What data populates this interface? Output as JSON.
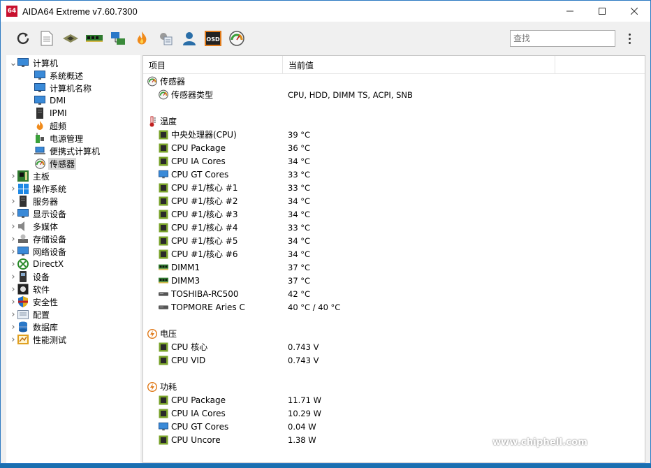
{
  "window": {
    "title": "AIDA64 Extreme v7.60.7300",
    "app_icon_text": "64"
  },
  "toolbar": {
    "icons": [
      "refresh-icon",
      "report-icon",
      "motherboard-icon",
      "memory-icon",
      "network-icon",
      "flame-icon",
      "tools-icon",
      "user-icon",
      "osd-icon",
      "sensor-gauge-icon"
    ],
    "osd_label": "OSD",
    "search_placeholder": "查找"
  },
  "tree": {
    "items": [
      {
        "label": "计算机",
        "level": 0,
        "expanded": true,
        "icon": "computer-icon"
      },
      {
        "label": "系统概述",
        "level": 1,
        "icon": "monitor-icon"
      },
      {
        "label": "计算机名称",
        "level": 1,
        "icon": "monitor-icon"
      },
      {
        "label": "DMI",
        "level": 1,
        "icon": "monitor-icon"
      },
      {
        "label": "IPMI",
        "level": 1,
        "icon": "server-icon"
      },
      {
        "label": "超频",
        "level": 1,
        "icon": "flame-icon"
      },
      {
        "label": "电源管理",
        "level": 1,
        "icon": "battery-icon"
      },
      {
        "label": "便携式计算机",
        "level": 1,
        "icon": "laptop-icon"
      },
      {
        "label": "传感器",
        "level": 1,
        "icon": "sensor-gauge-icon",
        "selected": true
      },
      {
        "label": "主板",
        "level": 0,
        "icon": "motherboard-icon"
      },
      {
        "label": "操作系统",
        "level": 0,
        "icon": "windows-icon"
      },
      {
        "label": "服务器",
        "level": 0,
        "icon": "server-icon"
      },
      {
        "label": "显示设备",
        "level": 0,
        "icon": "monitor-icon"
      },
      {
        "label": "多媒体",
        "level": 0,
        "icon": "speaker-icon"
      },
      {
        "label": "存储设备",
        "level": 0,
        "icon": "storage-icon"
      },
      {
        "label": "网络设备",
        "level": 0,
        "icon": "network-icon"
      },
      {
        "label": "DirectX",
        "level": 0,
        "icon": "xbox-icon"
      },
      {
        "label": "设备",
        "level": 0,
        "icon": "device-icon"
      },
      {
        "label": "软件",
        "level": 0,
        "icon": "software-icon"
      },
      {
        "label": "安全性",
        "level": 0,
        "icon": "shield-icon"
      },
      {
        "label": "配置",
        "level": 0,
        "icon": "config-icon"
      },
      {
        "label": "数据库",
        "level": 0,
        "icon": "database-icon"
      },
      {
        "label": "性能测试",
        "level": 0,
        "icon": "benchmark-icon"
      }
    ]
  },
  "table": {
    "columns": [
      "项目",
      "当前值"
    ],
    "sections": [
      {
        "title": "传感器",
        "icon": "sensor-gauge-icon",
        "rows": [
          {
            "name": "传感器类型",
            "value": "CPU, HDD, DIMM TS, ACPI, SNB",
            "icon": "sensor-gauge-icon"
          }
        ]
      },
      {
        "title": "温度",
        "icon": "thermometer-icon",
        "rows": [
          {
            "name": "中央处理器(CPU)",
            "value": "39 °C",
            "icon": "cpu-chip-icon"
          },
          {
            "name": "CPU Package",
            "value": "36 °C",
            "icon": "cpu-chip-icon"
          },
          {
            "name": "CPU IA Cores",
            "value": "34 °C",
            "icon": "cpu-chip-icon"
          },
          {
            "name": "CPU GT Cores",
            "value": "33 °C",
            "icon": "monitor-icon"
          },
          {
            "name": "CPU #1/核心 #1",
            "value": "33 °C",
            "icon": "cpu-chip-icon"
          },
          {
            "name": "CPU #1/核心 #2",
            "value": "34 °C",
            "icon": "cpu-chip-icon"
          },
          {
            "name": "CPU #1/核心 #3",
            "value": "34 °C",
            "icon": "cpu-chip-icon"
          },
          {
            "name": "CPU #1/核心 #4",
            "value": "33 °C",
            "icon": "cpu-chip-icon"
          },
          {
            "name": "CPU #1/核心 #5",
            "value": "34 °C",
            "icon": "cpu-chip-icon"
          },
          {
            "name": "CPU #1/核心 #6",
            "value": "34 °C",
            "icon": "cpu-chip-icon"
          },
          {
            "name": "DIMM1",
            "value": "37 °C",
            "icon": "memory-icon"
          },
          {
            "name": "DIMM3",
            "value": "37 °C",
            "icon": "memory-icon"
          },
          {
            "name": "TOSHIBA-RC500",
            "value": "42 °C",
            "icon": "drive-icon"
          },
          {
            "name": "TOPMORE Aries C",
            "value": "40 °C / 40 °C",
            "icon": "drive-icon"
          }
        ]
      },
      {
        "title": "电压",
        "icon": "voltage-icon",
        "rows": [
          {
            "name": "CPU 核心",
            "value": "0.743 V",
            "icon": "cpu-chip-icon"
          },
          {
            "name": "CPU VID",
            "value": "0.743 V",
            "icon": "cpu-chip-icon"
          }
        ]
      },
      {
        "title": "功耗",
        "icon": "power-icon",
        "rows": [
          {
            "name": "CPU Package",
            "value": "11.71 W",
            "icon": "cpu-chip-icon"
          },
          {
            "name": "CPU IA Cores",
            "value": "10.29 W",
            "icon": "cpu-chip-icon"
          },
          {
            "name": "CPU GT Cores",
            "value": "0.04 W",
            "icon": "monitor-icon"
          },
          {
            "name": "CPU Uncore",
            "value": "1.38 W",
            "icon": "cpu-chip-icon"
          }
        ]
      }
    ]
  },
  "watermark": {
    "url": "www.chiphell.com",
    "logo_text": "chip hell"
  },
  "colors": {
    "accent": "#2b79c2",
    "selected_bg": "#d9d9d9",
    "chip_green": "#7aa32a"
  }
}
